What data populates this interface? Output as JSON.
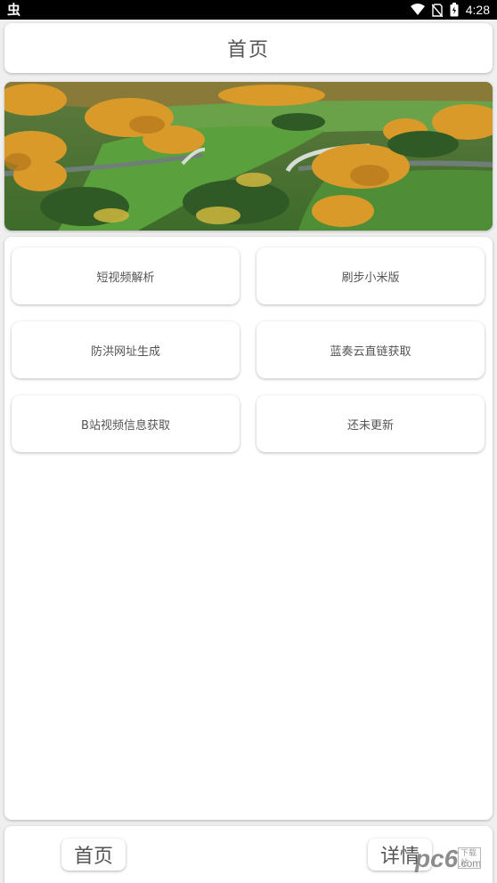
{
  "status_bar": {
    "time": "4:28",
    "icons": [
      "app-notification-icon",
      "wifi-icon",
      "no-sim-icon",
      "battery-icon"
    ]
  },
  "header": {
    "title": "首页"
  },
  "banner": {
    "image": "aerial-landscape-wildlife-bridge"
  },
  "tools": [
    {
      "label": "短视频解析"
    },
    {
      "label": "刷步小米版"
    },
    {
      "label": "防洪网址生成"
    },
    {
      "label": "蓝奏云直链获取"
    },
    {
      "label": "B站视频信息获取"
    },
    {
      "label": "还未更新"
    }
  ],
  "bottom_nav": {
    "home_label": "首页",
    "detail_label": "详情"
  },
  "watermark": {
    "brand": "pc6",
    "suffix": ".com",
    "tag": "下载站"
  },
  "colors": {
    "background": "#efefef",
    "card": "#ffffff",
    "text": "#555555"
  }
}
